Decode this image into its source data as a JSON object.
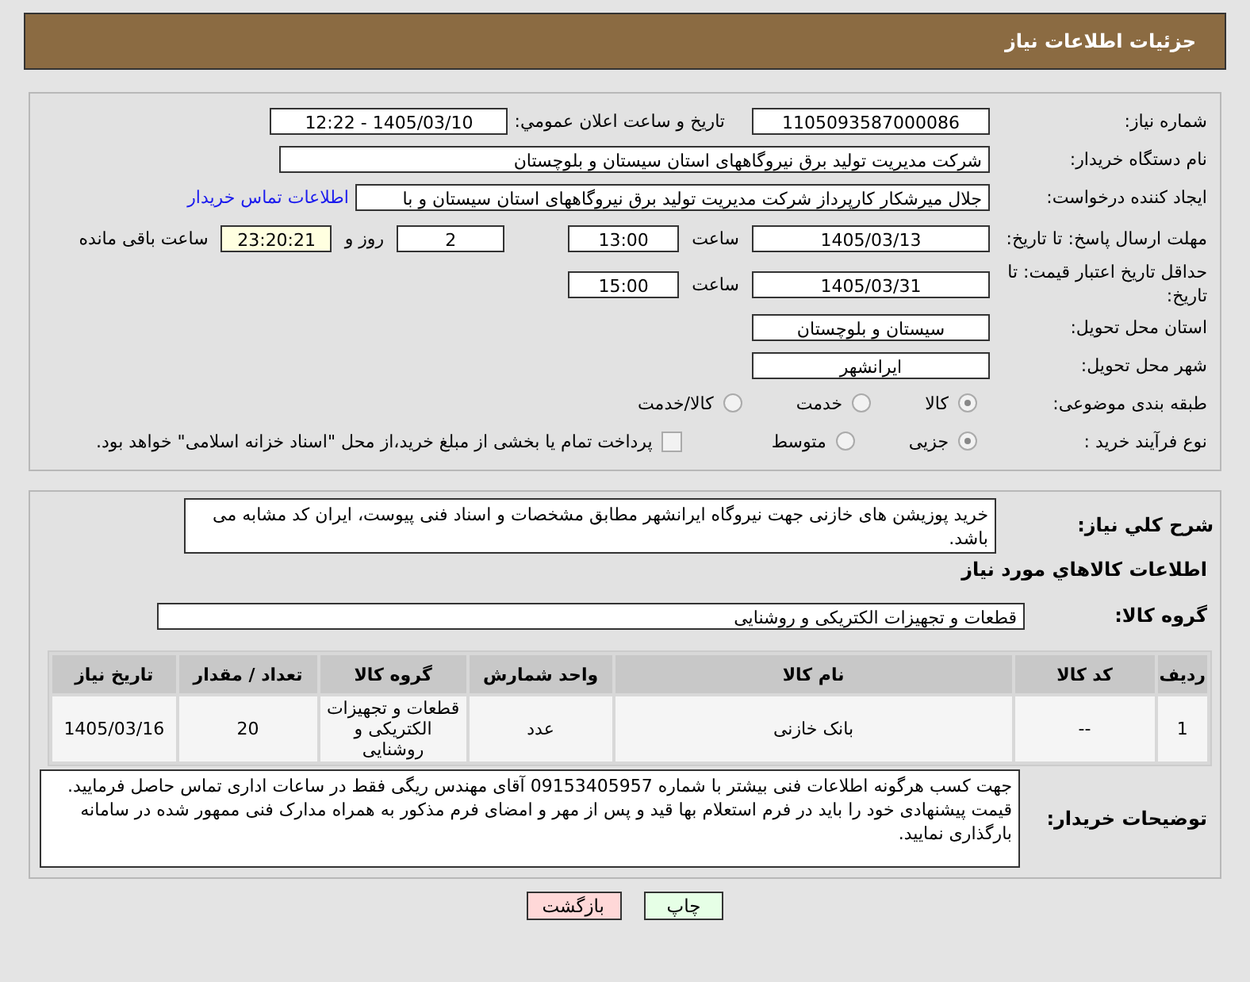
{
  "title": "جزئیات اطلاعات نیاز",
  "need_number": {
    "label": "شماره نیاز:",
    "value": "1105093587000086"
  },
  "announce": {
    "label": "تاریخ و ساعت اعلان عمومي:",
    "value": "1405/03/10 - 12:22"
  },
  "buyer_org": {
    "label": "نام دستگاه خریدار:",
    "value": "شرکت مدیریت تولید برق نیروگاههای استان سیستان و بلوچستان"
  },
  "requester": {
    "label": "ایجاد کننده درخواست:",
    "value": "جلال میرشکار کارپرداز شرکت مدیریت تولید برق نیروگاههای استان سیستان و با",
    "link": "اطلاعات تماس خریدار"
  },
  "reply_deadline": {
    "label": "مهلت ارسال پاسخ: تا تاریخ:",
    "date": "1405/03/13",
    "time_label": "ساعت",
    "time": "13:00",
    "days": "2",
    "days_label": "روز و",
    "remaining": "23:20:21",
    "remaining_label": "ساعت باقی مانده"
  },
  "price_validity": {
    "label": "حداقل تاریخ اعتبار قیمت: تا تاریخ:",
    "date": "1405/03/31",
    "time_label": "ساعت",
    "time": "15:00"
  },
  "province": {
    "label": "استان محل تحویل:",
    "value": "سیستان و بلوچستان"
  },
  "city": {
    "label": "شهر محل تحویل:",
    "value": "ایرانشهر"
  },
  "category": {
    "label": "طبقه بندی موضوعی:",
    "options": [
      {
        "label": "کالا",
        "selected": true
      },
      {
        "label": "خدمت",
        "selected": false
      },
      {
        "label": "کالا/خدمت",
        "selected": false
      }
    ]
  },
  "process": {
    "label": "نوع فرآیند خرید :",
    "options": [
      {
        "label": "جزیی",
        "selected": true
      },
      {
        "label": "متوسط",
        "selected": false
      }
    ],
    "payment": {
      "checked": false,
      "label": "پرداخت تمام یا بخشی از مبلغ خرید،از محل \"اسناد خزانه اسلامی\" خواهد بود."
    }
  },
  "description": {
    "label": "شرح کلي نياز:",
    "value": "خرید پوزیشن های خازنی جهت نیروگاه ایرانشهر مطابق مشخصات و اسناد فنی پیوست، ایران کد مشابه می باشد."
  },
  "goods_heading": "اطلاعات کالاهاي مورد نياز",
  "goods_group": {
    "label": "گروه کالا:",
    "value": "قطعات و تجهیزات الکتریکی و روشنایی"
  },
  "table": {
    "columns": [
      "ردیف",
      "کد کالا",
      "نام کالا",
      "واحد شمارش",
      "گروه کالا",
      "تعداد / مقدار",
      "تاریخ نیاز"
    ],
    "rows": [
      [
        "1",
        "--",
        "بانک خازنی",
        "عدد",
        "قطعات و تجهیزات الکتریکی و روشنایی",
        "20",
        "1405/03/16"
      ]
    ]
  },
  "buyer_notes": {
    "label": "توضیحات خریدار:",
    "value": "جهت کسب هرگونه اطلاعات فنی بیشتر با شماره 09153405957 آقای مهندس ریگی فقط در ساعات اداری تماس حاصل فرمایید. قیمت پیشنهادی خود را باید در فرم استعلام بها قید و پس از مهر و امضای فرم مذکور به همراه مدارک فنی ممهور شده در سامانه بارگذاری نمایید."
  },
  "buttons": [
    {
      "kind": "print",
      "label": "چاپ"
    },
    {
      "kind": "back",
      "label": "بازگشت"
    }
  ]
}
